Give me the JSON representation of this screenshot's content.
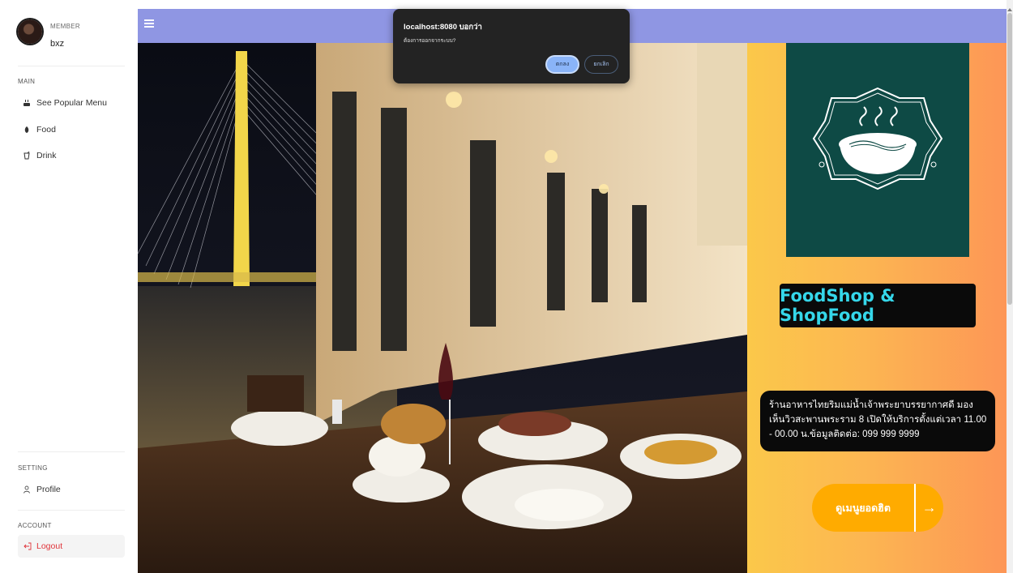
{
  "sidebar": {
    "member_role": "MEMBER",
    "member_name": "bxz",
    "main_section": "MAIN",
    "main_items": [
      {
        "label": "See Popular Menu",
        "icon": "cup-icon"
      },
      {
        "label": "Food",
        "icon": "food-icon"
      },
      {
        "label": "Drink",
        "icon": "drink-icon"
      }
    ],
    "setting_section": "SETTING",
    "profile_label": "Profile",
    "account_section": "ACCOUNT",
    "logout_label": "Logout"
  },
  "topbar": {
    "menu_icon": "hamburger-icon",
    "color": "#8f96e3"
  },
  "hero": {
    "image": "riverside restaurant at night with Rama VIII bridge"
  },
  "panel": {
    "logo": "noodle-bowl-logo",
    "brand_name": "FoodShop & ShopFood",
    "info_text": "ร้านอาหารไทยริมแม่น้ำเจ้าพระยาบรรยากาศดี มองเห็นวิวสะพานพระราม 8 เปิดให้บริการตั้งแต่เวลา 11.00 - 00.00 น.ข้อมูลติดต่อ: 099 999 9999",
    "cta_label": "ดูเมนูยอดฮิต",
    "cta_arrow": "→",
    "brand_color": "#35d7ea",
    "cta_color": "#ffab00"
  },
  "dialog": {
    "title": "localhost:8080 บอกว่า",
    "message": "ต้องการออกจากระบบ?",
    "ok_label": "ตกลง",
    "cancel_label": "ยกเลิก"
  }
}
